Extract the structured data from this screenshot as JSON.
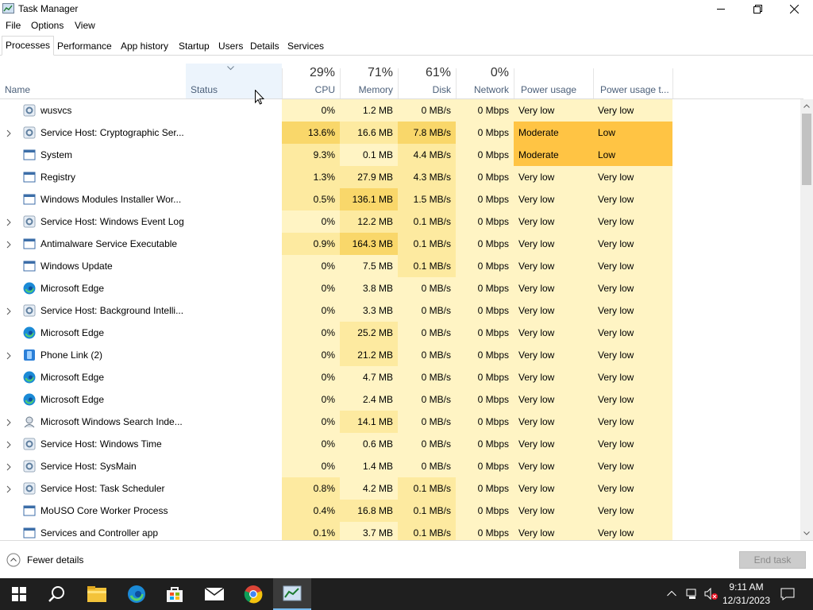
{
  "window": {
    "title": "Task Manager",
    "controls": {
      "minimize": "minimize",
      "maximize": "restore",
      "close": "close"
    }
  },
  "menu": {
    "items": [
      "File",
      "Options",
      "View"
    ]
  },
  "tabs": [
    "Processes",
    "Performance",
    "App history",
    "Startup",
    "Users",
    "Details",
    "Services"
  ],
  "active_tab": "Processes",
  "columns": {
    "name": {
      "label": "Name"
    },
    "status": {
      "label": "Status"
    },
    "cpu": {
      "label": "CPU",
      "pct": "29%"
    },
    "memory": {
      "label": "Memory",
      "pct": "71%"
    },
    "disk": {
      "label": "Disk",
      "pct": "61%"
    },
    "network": {
      "label": "Network",
      "pct": "0%"
    },
    "power": {
      "label": "Power usage"
    },
    "power_trend": {
      "label": "Power usage t..."
    }
  },
  "processes": [
    {
      "name": "wusvcs",
      "icon": "gear-icon",
      "expandable": false,
      "cpu": "0%",
      "memory": "1.2 MB",
      "disk": "0 MB/s",
      "network": "0 Mbps",
      "power": "Very low",
      "power_trend": "Very low"
    },
    {
      "name": "Service Host: Cryptographic Ser...",
      "icon": "gear-icon",
      "expandable": true,
      "cpu": "13.6%",
      "memory": "16.6 MB",
      "disk": "7.8 MB/s",
      "network": "0 Mbps",
      "power": "Moderate",
      "power_trend": "Low"
    },
    {
      "name": "System",
      "icon": "window-icon",
      "expandable": false,
      "cpu": "9.3%",
      "memory": "0.1 MB",
      "disk": "4.4 MB/s",
      "network": "0 Mbps",
      "power": "Moderate",
      "power_trend": "Low"
    },
    {
      "name": "Registry",
      "icon": "window-icon",
      "expandable": false,
      "cpu": "1.3%",
      "memory": "27.9 MB",
      "disk": "4.3 MB/s",
      "network": "0 Mbps",
      "power": "Very low",
      "power_trend": "Very low"
    },
    {
      "name": "Windows Modules Installer Wor...",
      "icon": "window-icon",
      "expandable": false,
      "cpu": "0.5%",
      "memory": "136.1 MB",
      "disk": "1.5 MB/s",
      "network": "0 Mbps",
      "power": "Very low",
      "power_trend": "Very low"
    },
    {
      "name": "Service Host: Windows Event Log",
      "icon": "gear-icon",
      "expandable": true,
      "cpu": "0%",
      "memory": "12.2 MB",
      "disk": "0.1 MB/s",
      "network": "0 Mbps",
      "power": "Very low",
      "power_trend": "Very low"
    },
    {
      "name": "Antimalware Service Executable",
      "icon": "window-icon",
      "expandable": true,
      "cpu": "0.9%",
      "memory": "164.3 MB",
      "disk": "0.1 MB/s",
      "network": "0 Mbps",
      "power": "Very low",
      "power_trend": "Very low"
    },
    {
      "name": "Windows Update",
      "icon": "window-icon",
      "expandable": false,
      "cpu": "0%",
      "memory": "7.5 MB",
      "disk": "0.1 MB/s",
      "network": "0 Mbps",
      "power": "Very low",
      "power_trend": "Very low"
    },
    {
      "name": "Microsoft Edge",
      "icon": "edge-icon",
      "expandable": false,
      "cpu": "0%",
      "memory": "3.8 MB",
      "disk": "0 MB/s",
      "network": "0 Mbps",
      "power": "Very low",
      "power_trend": "Very low"
    },
    {
      "name": "Service Host: Background Intelli...",
      "icon": "gear-icon",
      "expandable": true,
      "cpu": "0%",
      "memory": "3.3 MB",
      "disk": "0 MB/s",
      "network": "0 Mbps",
      "power": "Very low",
      "power_trend": "Very low"
    },
    {
      "name": "Microsoft Edge",
      "icon": "edge-icon",
      "expandable": false,
      "cpu": "0%",
      "memory": "25.2 MB",
      "disk": "0 MB/s",
      "network": "0 Mbps",
      "power": "Very low",
      "power_trend": "Very low"
    },
    {
      "name": "Phone Link (2)",
      "icon": "phone-link-icon",
      "expandable": true,
      "cpu": "0%",
      "memory": "21.2 MB",
      "disk": "0 MB/s",
      "network": "0 Mbps",
      "power": "Very low",
      "power_trend": "Very low"
    },
    {
      "name": "Microsoft Edge",
      "icon": "edge-icon",
      "expandable": false,
      "cpu": "0%",
      "memory": "4.7 MB",
      "disk": "0 MB/s",
      "network": "0 Mbps",
      "power": "Very low",
      "power_trend": "Very low"
    },
    {
      "name": "Microsoft Edge",
      "icon": "edge-icon",
      "expandable": false,
      "cpu": "0%",
      "memory": "2.4 MB",
      "disk": "0 MB/s",
      "network": "0 Mbps",
      "power": "Very low",
      "power_trend": "Very low"
    },
    {
      "name": "Microsoft Windows Search Inde...",
      "icon": "search-indexer-icon",
      "expandable": true,
      "cpu": "0%",
      "memory": "14.1 MB",
      "disk": "0 MB/s",
      "network": "0 Mbps",
      "power": "Very low",
      "power_trend": "Very low"
    },
    {
      "name": "Service Host: Windows Time",
      "icon": "gear-icon",
      "expandable": true,
      "cpu": "0%",
      "memory": "0.6 MB",
      "disk": "0 MB/s",
      "network": "0 Mbps",
      "power": "Very low",
      "power_trend": "Very low"
    },
    {
      "name": "Service Host: SysMain",
      "icon": "gear-icon",
      "expandable": true,
      "cpu": "0%",
      "memory": "1.4 MB",
      "disk": "0 MB/s",
      "network": "0 Mbps",
      "power": "Very low",
      "power_trend": "Very low"
    },
    {
      "name": "Service Host: Task Scheduler",
      "icon": "gear-icon",
      "expandable": true,
      "cpu": "0.8%",
      "memory": "4.2 MB",
      "disk": "0.1 MB/s",
      "network": "0 Mbps",
      "power": "Very low",
      "power_trend": "Very low"
    },
    {
      "name": "MoUSO Core Worker Process",
      "icon": "window-icon",
      "expandable": false,
      "cpu": "0.4%",
      "memory": "16.8 MB",
      "disk": "0.1 MB/s",
      "network": "0 Mbps",
      "power": "Very low",
      "power_trend": "Very low"
    },
    {
      "name": "Services and Controller app",
      "icon": "window-icon",
      "expandable": false,
      "cpu": "0.1%",
      "memory": "3.7 MB",
      "disk": "0.1 MB/s",
      "network": "0 Mbps",
      "power": "Very low",
      "power_trend": "Very low"
    }
  ],
  "footer": {
    "fewer_details": "Fewer details",
    "end_task": "End task"
  },
  "taskbar": {
    "apps": [
      "start-icon",
      "search-icon",
      "file-explorer-icon",
      "edge-icon",
      "store-icon",
      "mail-icon",
      "chrome-icon",
      "task-manager-icon"
    ],
    "clock_time": "9:11 AM",
    "clock_date": "12/31/2023"
  },
  "colors": {
    "heat_light": "#fff4c4",
    "heat_mid": "#fdeaa0",
    "heat_strong": "#f9d76a",
    "heat_high": "#ffc444",
    "accent": "#0078d7"
  }
}
